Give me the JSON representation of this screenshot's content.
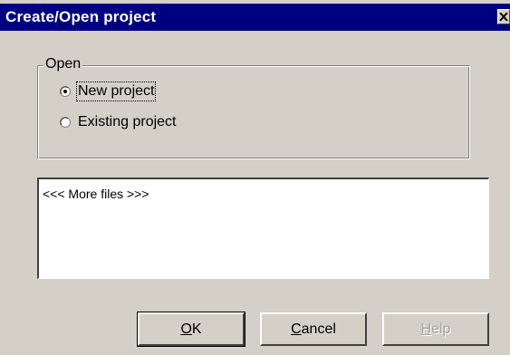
{
  "window": {
    "title": "Create/Open project",
    "close_icon": "close-x-icon"
  },
  "open_group": {
    "label": "Open",
    "options": [
      {
        "label": "New project",
        "selected": true
      },
      {
        "label": "Existing project",
        "selected": false
      }
    ]
  },
  "file_list": {
    "items": [
      "<<< More files >>>"
    ]
  },
  "buttons": {
    "ok": {
      "mnemonic": "O",
      "rest": "K",
      "enabled": true
    },
    "cancel": {
      "mnemonic": "C",
      "rest": "ancel",
      "enabled": true
    },
    "help": {
      "mnemonic": "H",
      "rest": "elp",
      "enabled": false
    }
  }
}
